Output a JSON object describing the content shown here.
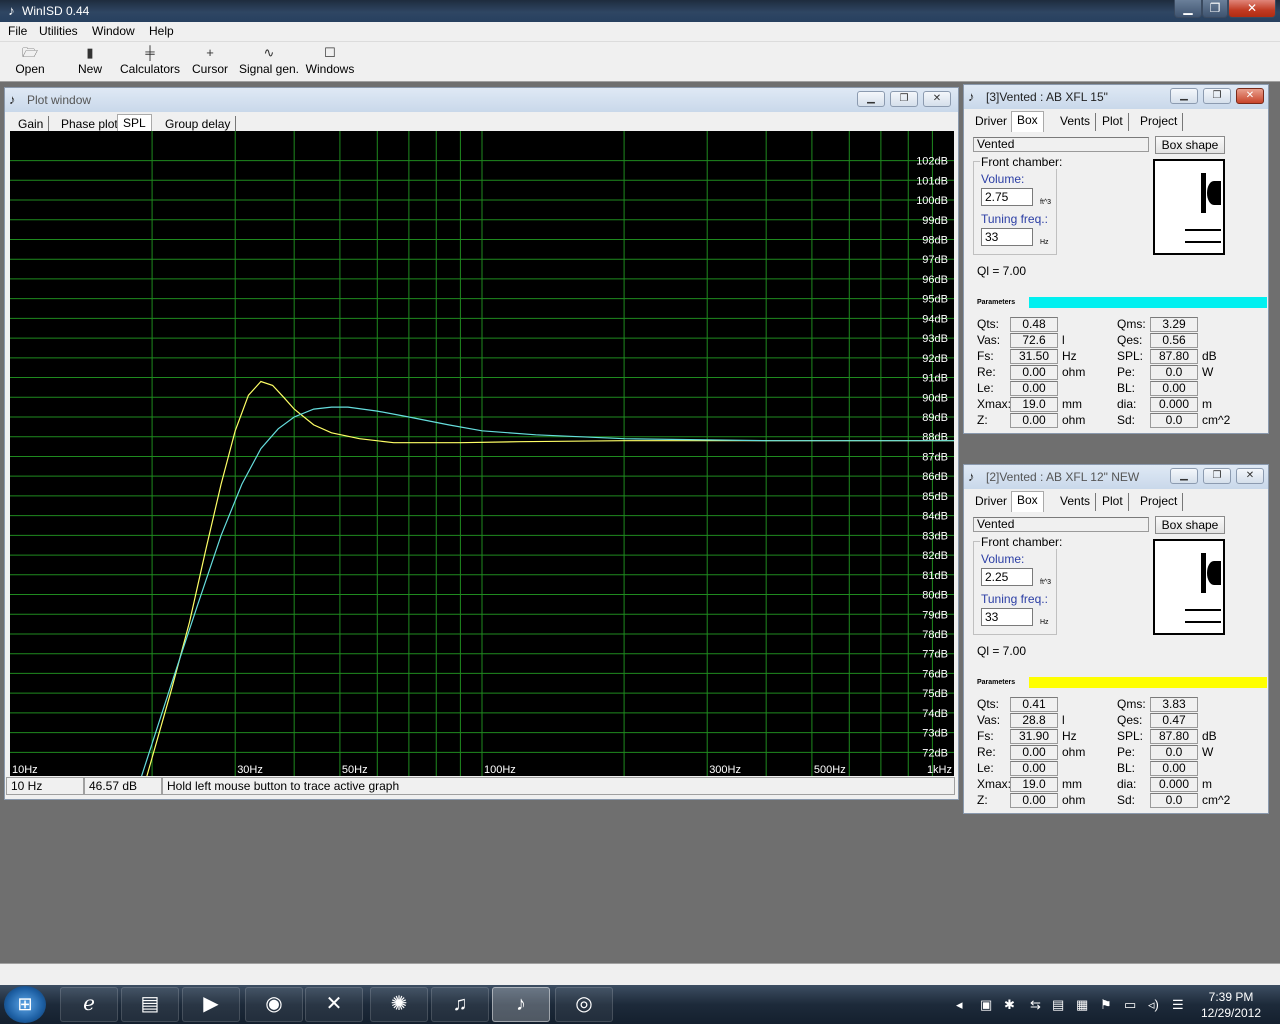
{
  "app": {
    "title": "WinISD 0.44",
    "menu": [
      "File",
      "Utilities",
      "Window",
      "Help"
    ],
    "toolbar": [
      {
        "label": "Open",
        "icon": "open-folder-icon"
      },
      {
        "label": "New",
        "icon": "new-project-icon"
      },
      {
        "label": "Calculators",
        "icon": "calculator-icon"
      },
      {
        "label": "Cursor",
        "icon": "crosshair-icon"
      },
      {
        "label": "Signal gen.",
        "icon": "signal-generator-icon"
      },
      {
        "label": "Windows",
        "icon": "windows-icon"
      }
    ]
  },
  "plot_window": {
    "title": "Plot window",
    "tabs": [
      "Gain",
      "Phase plot",
      "SPL",
      "Group delay"
    ],
    "selected_tab": "SPL",
    "status": {
      "freq": "10 Hz",
      "level": "46.57 dB",
      "hint": "Hold left mouse button to trace active graph"
    }
  },
  "chart_data": {
    "type": "line",
    "x_scale": "log",
    "xlim": [
      10,
      1000
    ],
    "ylim": [
      70.8,
      103.5
    ],
    "x_ticks": [
      {
        "value": 10,
        "label": "10Hz"
      },
      {
        "value": 30,
        "label": "30Hz"
      },
      {
        "value": 50,
        "label": "50Hz"
      },
      {
        "value": 100,
        "label": "100Hz"
      },
      {
        "value": 300,
        "label": "300Hz"
      },
      {
        "value": 500,
        "label": "500Hz"
      },
      {
        "value": 1000,
        "label": "1kHz"
      }
    ],
    "y_ticks": [
      "102dB",
      "101dB",
      "100dB",
      "99dB",
      "98dB",
      "97dB",
      "96dB",
      "95dB",
      "94dB",
      "93dB",
      "92dB",
      "91dB",
      "90dB",
      "89dB",
      "88dB",
      "87dB",
      "86dB",
      "85dB",
      "84dB",
      "83dB",
      "82dB",
      "81dB",
      "80dB",
      "79dB",
      "78dB",
      "77dB",
      "76dB",
      "75dB",
      "74dB",
      "73dB",
      "72dB"
    ],
    "grid": true,
    "background": "#000000",
    "grid_color": "#1f8a1f",
    "series": [
      {
        "color": "#ffff66",
        "x": [
          19.5,
          22,
          24,
          26,
          28,
          30,
          32,
          34,
          36,
          38,
          40,
          44,
          48,
          55,
          65,
          75,
          90,
          120,
          200,
          400,
          1000
        ],
        "y": [
          70.8,
          75.2,
          78.6,
          82.3,
          85.6,
          88.3,
          90.1,
          90.8,
          90.6,
          90.0,
          89.4,
          88.6,
          88.2,
          87.9,
          87.7,
          87.7,
          87.7,
          87.75,
          87.8,
          87.8,
          87.8
        ]
      },
      {
        "color": "#66dddd",
        "x": [
          19.0,
          22,
          25,
          28,
          31,
          34,
          37,
          40,
          44,
          48,
          52,
          60,
          70,
          85,
          100,
          130,
          200,
          400,
          1000
        ],
        "y": [
          70.8,
          75.5,
          79.5,
          83.0,
          85.6,
          87.4,
          88.4,
          89.0,
          89.4,
          89.5,
          89.5,
          89.3,
          89.0,
          88.6,
          88.3,
          88.1,
          87.9,
          87.8,
          87.8
        ]
      }
    ]
  },
  "panel1": {
    "title": "[3]Vented : AB XFL 15\"",
    "tabs": [
      "Driver",
      "Box",
      "Vents",
      "Plot",
      "Project"
    ],
    "box_type": "Vented",
    "box_shape_btn": "Box shape",
    "front_chamber": "Front chamber:",
    "volume_label": "Volume:",
    "volume": "2.75",
    "volume_unit": "ft^3",
    "tuning_label": "Tuning freq.:",
    "tuning": "33",
    "tuning_unit": "Hz",
    "ql": "Ql = 7.00",
    "params_label": "Parameters",
    "params_color": "#00f0f0",
    "params": [
      {
        "l": "Qts:",
        "v": "0.48",
        "u": "",
        "l2": "Qms:",
        "v2": "3.29",
        "u2": ""
      },
      {
        "l": "Vas:",
        "v": "72.6",
        "u": "l",
        "l2": "Qes:",
        "v2": "0.56",
        "u2": ""
      },
      {
        "l": "Fs:",
        "v": "31.50",
        "u": "Hz",
        "l2": "SPL:",
        "v2": "87.80",
        "u2": "dB"
      },
      {
        "l": "Re:",
        "v": "0.00",
        "u": "ohm",
        "l2": "Pe:",
        "v2": "0.0",
        "u2": "W"
      },
      {
        "l": "Le:",
        "v": "0.00",
        "u": "",
        "l2": "BL:",
        "v2": "0.00",
        "u2": ""
      },
      {
        "l": "Xmax:",
        "v": "19.0",
        "u": "mm",
        "l2": "dia:",
        "v2": "0.000",
        "u2": "m"
      },
      {
        "l": "Z:",
        "v": "0.00",
        "u": "ohm",
        "l2": "Sd:",
        "v2": "0.0",
        "u2": "cm^2"
      }
    ]
  },
  "panel2": {
    "title": "[2]Vented : AB XFL 12\" NEW",
    "tabs": [
      "Driver",
      "Box",
      "Vents",
      "Plot",
      "Project"
    ],
    "box_type": "Vented",
    "box_shape_btn": "Box shape",
    "front_chamber": "Front chamber:",
    "volume_label": "Volume:",
    "volume": "2.25",
    "volume_unit": "ft^3",
    "tuning_label": "Tuning freq.:",
    "tuning": "33",
    "tuning_unit": "Hz",
    "ql": "Ql = 7.00",
    "params_label": "Parameters",
    "params_color": "#ffff00",
    "params": [
      {
        "l": "Qts:",
        "v": "0.41",
        "u": "",
        "l2": "Qms:",
        "v2": "3.83",
        "u2": ""
      },
      {
        "l": "Vas:",
        "v": "28.8",
        "u": "l",
        "l2": "Qes:",
        "v2": "0.47",
        "u2": ""
      },
      {
        "l": "Fs:",
        "v": "31.90",
        "u": "Hz",
        "l2": "SPL:",
        "v2": "87.80",
        "u2": "dB"
      },
      {
        "l": "Re:",
        "v": "0.00",
        "u": "ohm",
        "l2": "Pe:",
        "v2": "0.0",
        "u2": "W"
      },
      {
        "l": "Le:",
        "v": "0.00",
        "u": "",
        "l2": "BL:",
        "v2": "0.00",
        "u2": ""
      },
      {
        "l": "Xmax:",
        "v": "19.0",
        "u": "mm",
        "l2": "dia:",
        "v2": "0.000",
        "u2": "m"
      },
      {
        "l": "Z:",
        "v": "0.00",
        "u": "ohm",
        "l2": "Sd:",
        "v2": "0.0",
        "u2": "cm^2"
      }
    ]
  },
  "taskbar": {
    "apps": [
      {
        "name": "internet-explorer",
        "icon": "ie-icon"
      },
      {
        "name": "file-explorer",
        "icon": "folder-icon"
      },
      {
        "name": "media-player",
        "icon": "media-player-icon"
      },
      {
        "name": "chrome",
        "icon": "chrome-icon"
      },
      {
        "name": "xsplit",
        "icon": "x-app-icon"
      },
      {
        "name": "audio-tool",
        "icon": "audio-tool-icon"
      },
      {
        "name": "itunes",
        "icon": "itunes-icon"
      },
      {
        "name": "winisd",
        "icon": "winisd-icon"
      },
      {
        "name": "speaker-app",
        "icon": "speaker-icon"
      }
    ],
    "time": "7:39 PM",
    "date": "12/29/2012"
  }
}
